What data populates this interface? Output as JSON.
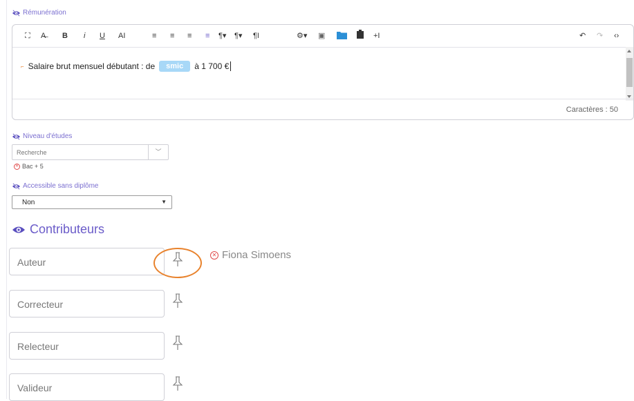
{
  "remuneration": {
    "label": "Rémunération",
    "toolbar_left": [
      "⛶",
      "A̶",
      "B",
      "i",
      "U",
      "AI",
      "≡",
      "≡",
      "≡",
      "≡",
      "¶▾",
      "¶▾",
      "¶I",
      "⚙▾",
      "▣",
      "▮",
      "▮",
      "+I"
    ],
    "toolbar_right": [
      "↶",
      "↷",
      "‹›"
    ],
    "content": {
      "prefix": "Salaire brut mensuel débutant : de",
      "smic": "smic",
      "suffix": "à 1 700 €"
    },
    "char_count": "Caractères : 50"
  },
  "niveau": {
    "label": "Niveau d'études",
    "search_placeholder": "Recherche",
    "selected_tag": "Bac + 5"
  },
  "accessible": {
    "label": "Accessible sans diplôme",
    "value": "Non"
  },
  "contributeurs": {
    "title": "Contributeurs",
    "roles": [
      {
        "label": "Auteur",
        "person": "Fiona Simoens"
      },
      {
        "label": "Correcteur"
      },
      {
        "label": "Relecteur"
      },
      {
        "label": "Valideur"
      }
    ]
  },
  "colors": {
    "accent": "#6b5cc9",
    "highlight_circle": "#e8822c",
    "smic_tag": "#a8d8f7",
    "remove_icon": "#e04a4a"
  }
}
